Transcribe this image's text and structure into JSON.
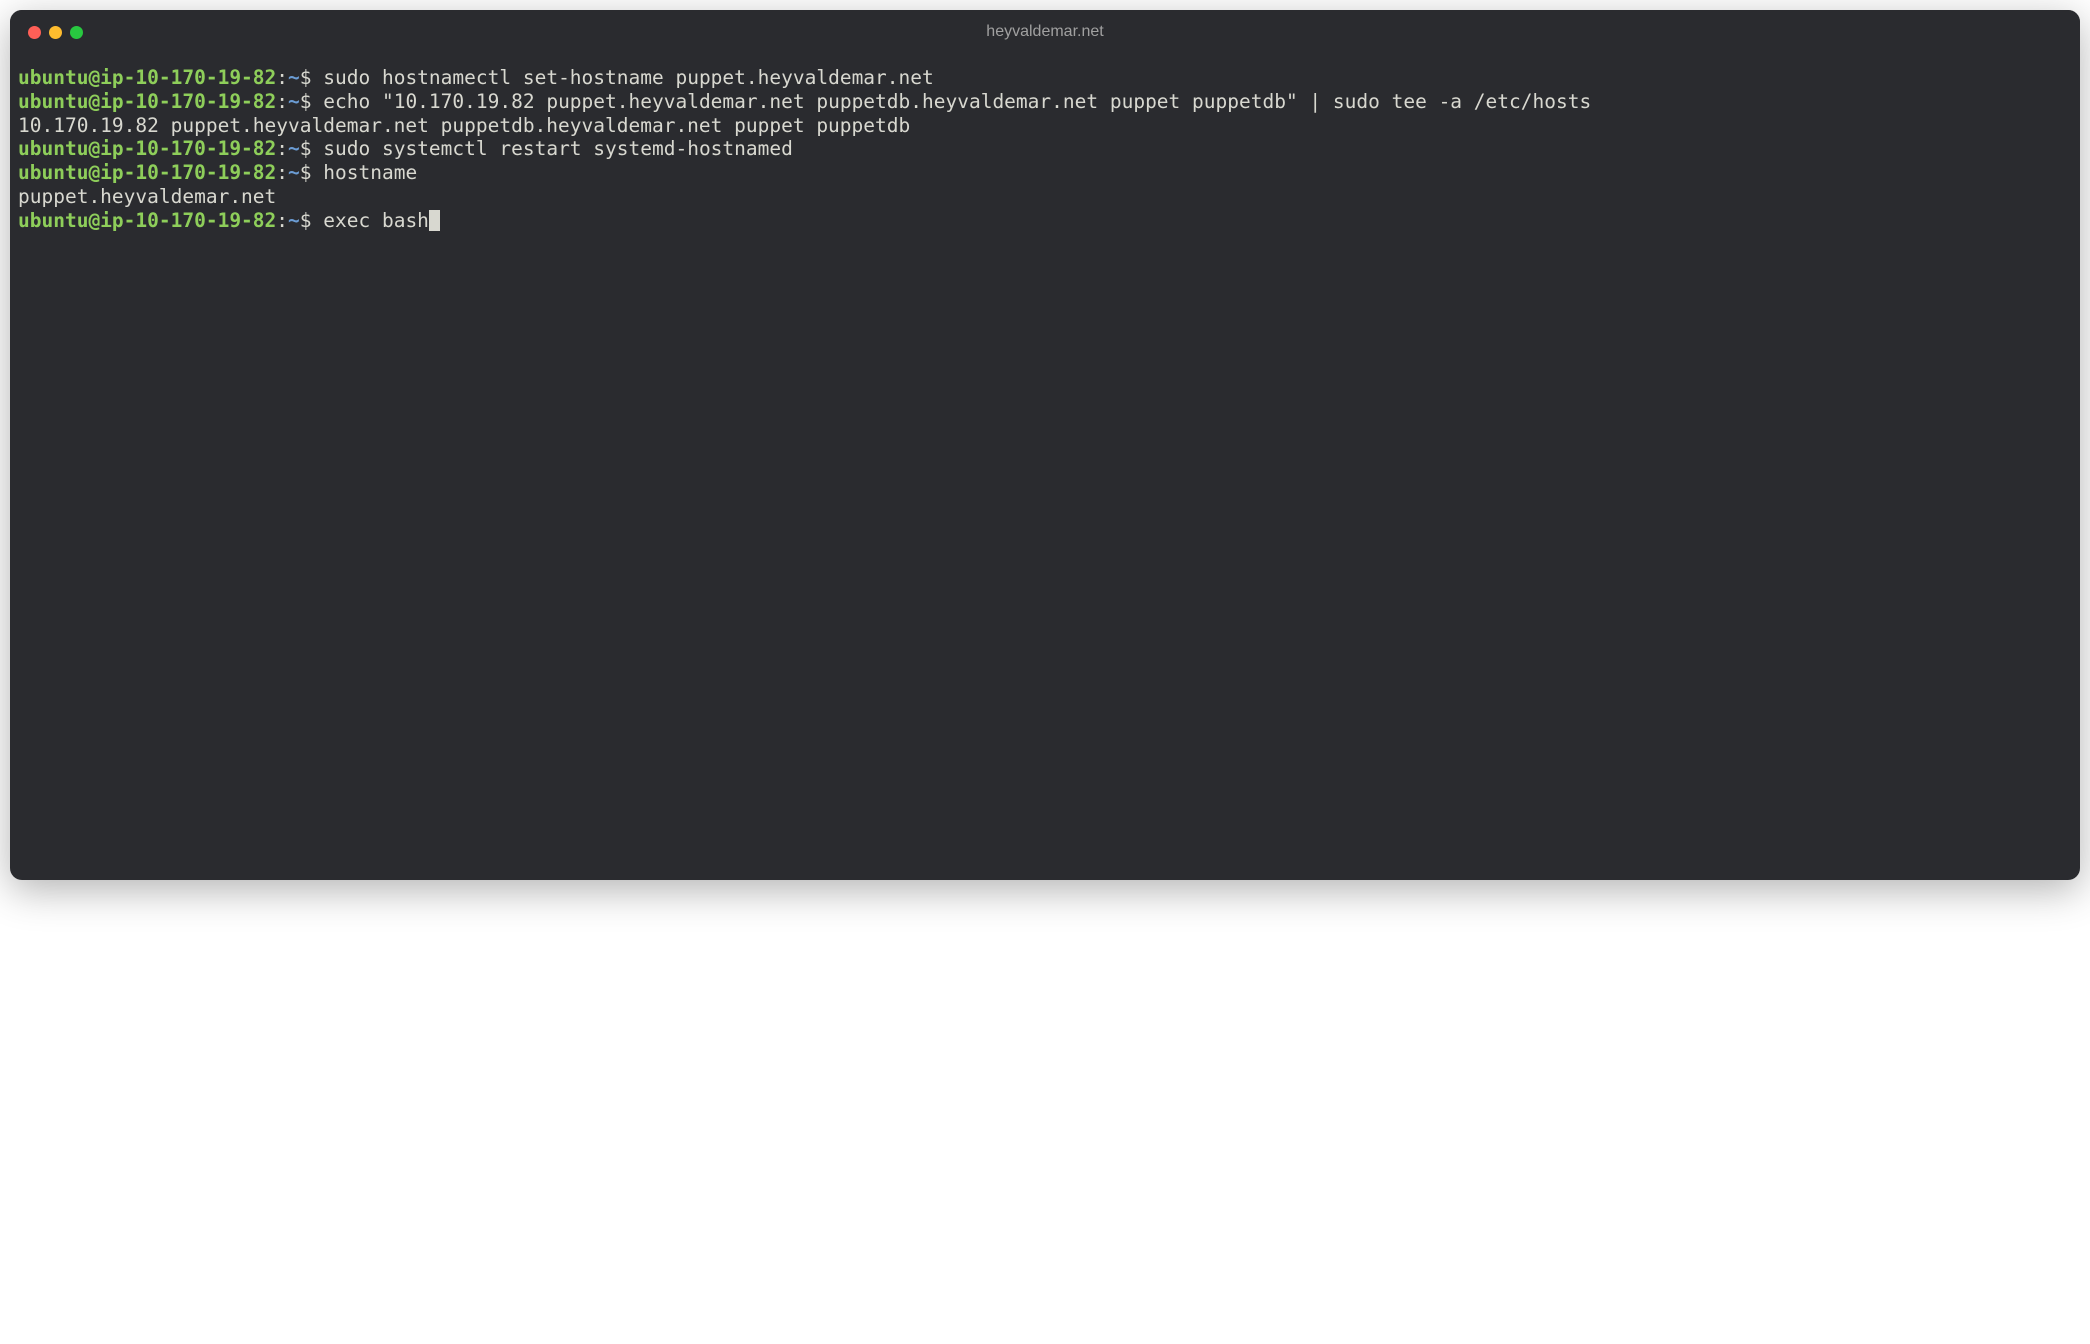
{
  "window": {
    "title": "heyvaldemar.net"
  },
  "prompt": {
    "user_host": "ubuntu@ip-10-170-19-82",
    "sep1": ":",
    "path": "~",
    "sep2": "$ "
  },
  "session": {
    "line1_cmd": "sudo hostnamectl set-hostname puppet.heyvaldemar.net",
    "line2_cmd": "echo \"10.170.19.82 puppet.heyvaldemar.net puppetdb.heyvaldemar.net puppet puppetdb\" | sudo tee -a /etc/hosts",
    "line3_out": "10.170.19.82 puppet.heyvaldemar.net puppetdb.heyvaldemar.net puppet puppetdb",
    "line4_cmd": "sudo systemctl restart systemd-hostnamed",
    "line5_cmd": "hostname",
    "line6_out": "puppet.heyvaldemar.net",
    "line7_cmd": "exec bash"
  }
}
